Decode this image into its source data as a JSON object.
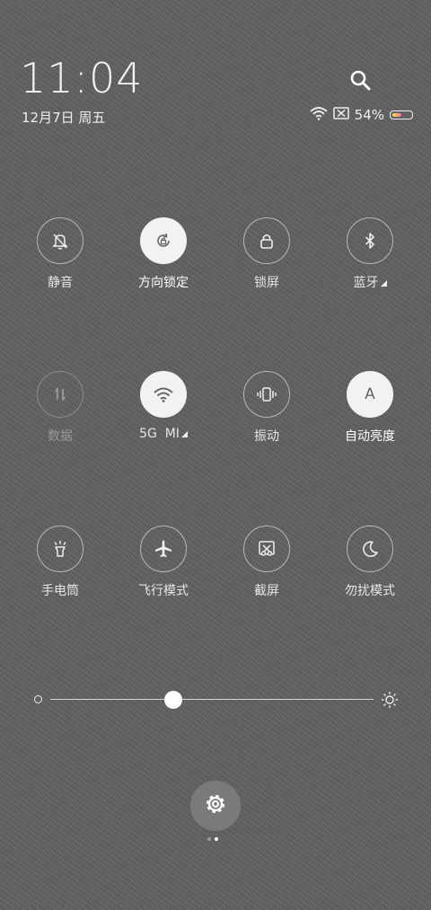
{
  "status": {
    "time": "11:04",
    "date": "12月7日 周五",
    "battery_text": "54%",
    "battery_level": 0.54
  },
  "tiles": [
    {
      "label": "静音",
      "icon": "bell-off-icon",
      "state": "off"
    },
    {
      "label": "方向锁定",
      "icon": "rotation-lock-icon",
      "state": "on"
    },
    {
      "label": "锁屏",
      "icon": "lock-icon",
      "state": "off"
    },
    {
      "label": "蓝牙",
      "icon": "bluetooth-icon",
      "state": "off"
    },
    {
      "label": "数据",
      "icon": "mobile-data-icon",
      "state": "disabled"
    },
    {
      "label": "5G  MI",
      "icon": "wifi-icon",
      "state": "on"
    },
    {
      "label": "振动",
      "icon": "vibrate-icon",
      "state": "off"
    },
    {
      "label": "自动亮度",
      "icon": "auto-brightness-icon",
      "state": "on",
      "glyph": "A"
    },
    {
      "label": "手电筒",
      "icon": "flashlight-icon",
      "state": "off"
    },
    {
      "label": "飞行模式",
      "icon": "airplane-icon",
      "state": "off"
    },
    {
      "label": "截屏",
      "icon": "screenshot-icon",
      "state": "off"
    },
    {
      "label": "勿扰模式",
      "icon": "moon-icon",
      "state": "off"
    }
  ],
  "brightness": {
    "level": 0.38
  },
  "pager": {
    "pages": 2,
    "active": 2
  },
  "colors": {
    "accent_on": "#f2f2f2",
    "background": "#5f5f5f"
  }
}
